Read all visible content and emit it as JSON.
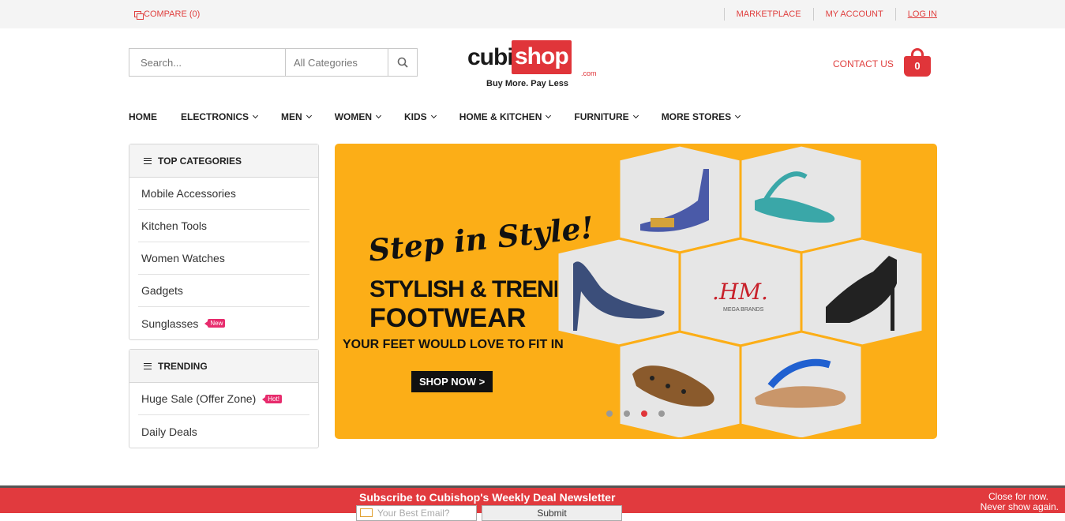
{
  "topbar": {
    "compare_label": "COMPARE (0)",
    "links": [
      "MARKETPLACE",
      "MY ACCOUNT",
      "LOG IN"
    ]
  },
  "header": {
    "search_placeholder": "Search...",
    "category_select": "All Categories",
    "logo_cubi": "cubi",
    "logo_shop": "shop",
    "logo_dotcom": ".com",
    "logo_tagline": "Buy More. Pay Less",
    "contact_label": "CONTACT US",
    "cart_count": "0"
  },
  "nav": {
    "items": [
      "HOME",
      "ELECTRONICS",
      "MEN",
      "WOMEN",
      "KIDS",
      "HOME & KITCHEN",
      "FURNITURE",
      "MORE STORES"
    ]
  },
  "sidebar": {
    "top_categories": {
      "title": "TOP CATEGORIES",
      "items": [
        "Mobile Accessories",
        "Kitchen Tools",
        "Women Watches",
        "Gadgets",
        "Sunglasses"
      ],
      "badge": "New"
    },
    "trending": {
      "title": "TRENDING",
      "items": [
        "Huge Sale (Offer Zone)",
        "Daily Deals"
      ],
      "badge": "Hot!"
    }
  },
  "banner": {
    "script_line": "Step in Style!",
    "line1": "STYLISH & TRENDY",
    "line2": "FOOTWEAR",
    "line3": "YOUR FEET WOULD LOVE TO FIT IN",
    "button": "SHOP NOW >",
    "brand": ".HM.",
    "brand_sub": "MEGA BRANDS",
    "slide_count": 4,
    "active_slide": 3
  },
  "newsletter": {
    "title": "Subscribe to Cubishop's Weekly Deal Newsletter",
    "email_placeholder": "Your Best Email?",
    "submit": "Submit",
    "close_now": "Close for now.",
    "never_show": "Never show again."
  },
  "colors": {
    "accent": "#e0353a",
    "banner_bg": "#fcae17",
    "badge": "#e72c6d"
  }
}
